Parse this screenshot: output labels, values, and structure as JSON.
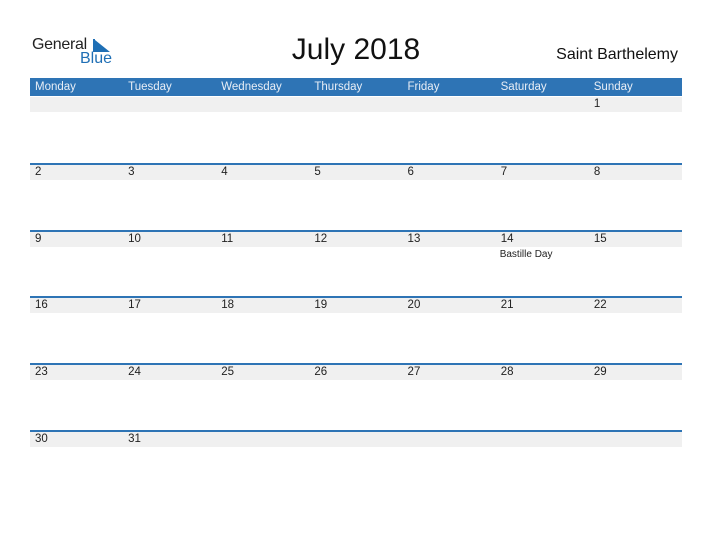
{
  "logo": {
    "general": "General",
    "blue": "Blue"
  },
  "title": "July 2018",
  "country": "Saint Barthelemy",
  "accent_color": "#2e74b5",
  "weekdays": [
    "Monday",
    "Tuesday",
    "Wednesday",
    "Thursday",
    "Friday",
    "Saturday",
    "Sunday"
  ],
  "weeks": [
    [
      {
        "day": ""
      },
      {
        "day": ""
      },
      {
        "day": ""
      },
      {
        "day": ""
      },
      {
        "day": ""
      },
      {
        "day": ""
      },
      {
        "day": "1"
      }
    ],
    [
      {
        "day": "2"
      },
      {
        "day": "3"
      },
      {
        "day": "4"
      },
      {
        "day": "5"
      },
      {
        "day": "6"
      },
      {
        "day": "7"
      },
      {
        "day": "8"
      }
    ],
    [
      {
        "day": "9"
      },
      {
        "day": "10"
      },
      {
        "day": "11"
      },
      {
        "day": "12"
      },
      {
        "day": "13"
      },
      {
        "day": "14",
        "event": "Bastille Day"
      },
      {
        "day": "15"
      }
    ],
    [
      {
        "day": "16"
      },
      {
        "day": "17"
      },
      {
        "day": "18"
      },
      {
        "day": "19"
      },
      {
        "day": "20"
      },
      {
        "day": "21"
      },
      {
        "day": "22"
      }
    ],
    [
      {
        "day": "23"
      },
      {
        "day": "24"
      },
      {
        "day": "25"
      },
      {
        "day": "26"
      },
      {
        "day": "27"
      },
      {
        "day": "28"
      },
      {
        "day": "29"
      }
    ],
    [
      {
        "day": "30"
      },
      {
        "day": "31"
      },
      {
        "day": ""
      },
      {
        "day": ""
      },
      {
        "day": ""
      },
      {
        "day": ""
      },
      {
        "day": ""
      }
    ]
  ]
}
